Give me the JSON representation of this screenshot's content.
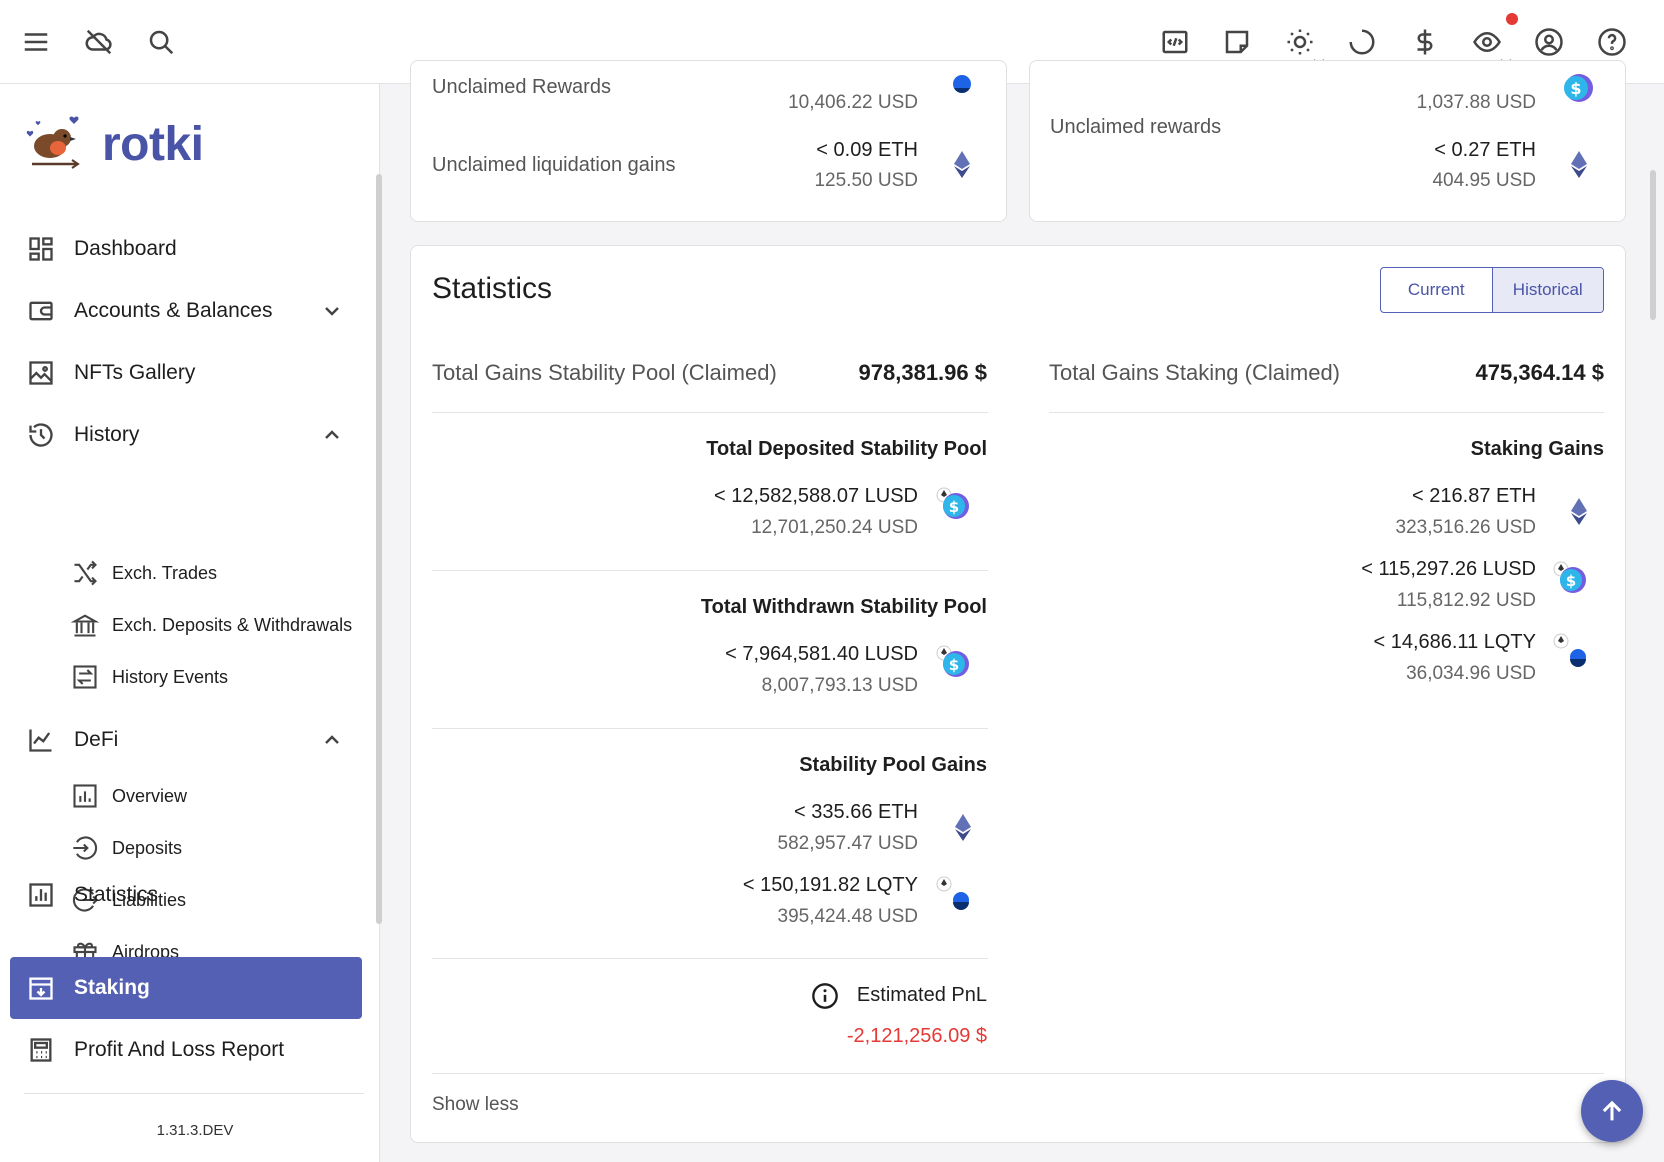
{
  "topbar": {
    "icons": [
      "menu-icon",
      "cloud-off-icon",
      "search-icon",
      "code-icon",
      "note-icon",
      "theme-icon",
      "loading-icon",
      "currency-icon",
      "privacy-eye-icon",
      "account-icon",
      "help-icon"
    ]
  },
  "sidebar": {
    "logo_text": "rotki",
    "version": "1.31.3.DEV",
    "items": {
      "dashboard": "Dashboard",
      "accounts": "Accounts & Balances",
      "nfts": "NFTs Gallery",
      "history": "History",
      "exch_trades": "Exch. Trades",
      "exch_deposits": "Exch. Deposits & Withdrawals",
      "history_events": "History Events",
      "defi": "DeFi",
      "overview": "Overview",
      "deposits": "Deposits",
      "liabilities": "Liabilities",
      "airdrops": "Airdrops",
      "statistics": "Statistics",
      "staking": "Staking",
      "pnl_report": "Profit And Loss Report"
    }
  },
  "top_left_card": {
    "unclaimed_rewards_label": "Unclaimed Rewards",
    "unclaimed_rewards_usd": "10,406.22 USD",
    "liquidation_label": "Unclaimed liquidation gains",
    "liquidation_eth": "< 0.09 ETH",
    "liquidation_usd": "125.50 USD"
  },
  "top_right_card": {
    "unclaimed_label": "Unclaimed rewards",
    "lusd_usd": "1,037.88 USD",
    "eth": "< 0.27 ETH",
    "eth_usd": "404.95 USD"
  },
  "statistics": {
    "title": "Statistics",
    "toggle_current": "Current",
    "toggle_historical": "Historical",
    "stability_total_label": "Total Gains Stability Pool (Claimed)",
    "stability_total_value": "978,381.96 $",
    "staking_total_label": "Total Gains Staking (Claimed)",
    "staking_total_value": "475,364.14 $",
    "deposited_title": "Total Deposited Stability Pool",
    "deposited_lusd": "< 12,582,588.07 LUSD",
    "deposited_usd": "12,701,250.24 USD",
    "withdrawn_title": "Total Withdrawn Stability Pool",
    "withdrawn_lusd": "< 7,964,581.40 LUSD",
    "withdrawn_usd": "8,007,793.13 USD",
    "sp_gains_title": "Stability Pool Gains",
    "sp_gains_eth": "< 335.66 ETH",
    "sp_gains_eth_usd": "582,957.47 USD",
    "sp_gains_lqty": "< 150,191.82 LQTY",
    "sp_gains_lqty_usd": "395,424.48 USD",
    "pnl_title": "Estimated PnL",
    "pnl_value": "-2,121,256.09 $",
    "staking_gains_title": "Staking Gains",
    "staking_eth": "< 216.87 ETH",
    "staking_eth_usd": "323,516.26 USD",
    "staking_lusd": "< 115,297.26 LUSD",
    "staking_lusd_usd": "115,812.92 USD",
    "staking_lqty": "< 14,686.11 LQTY",
    "staking_lqty_usd": "36,034.96 USD",
    "show_less": "Show less"
  },
  "colors": {
    "accent": "#5360b3",
    "negative": "#e53935",
    "badge": "#e53935"
  }
}
